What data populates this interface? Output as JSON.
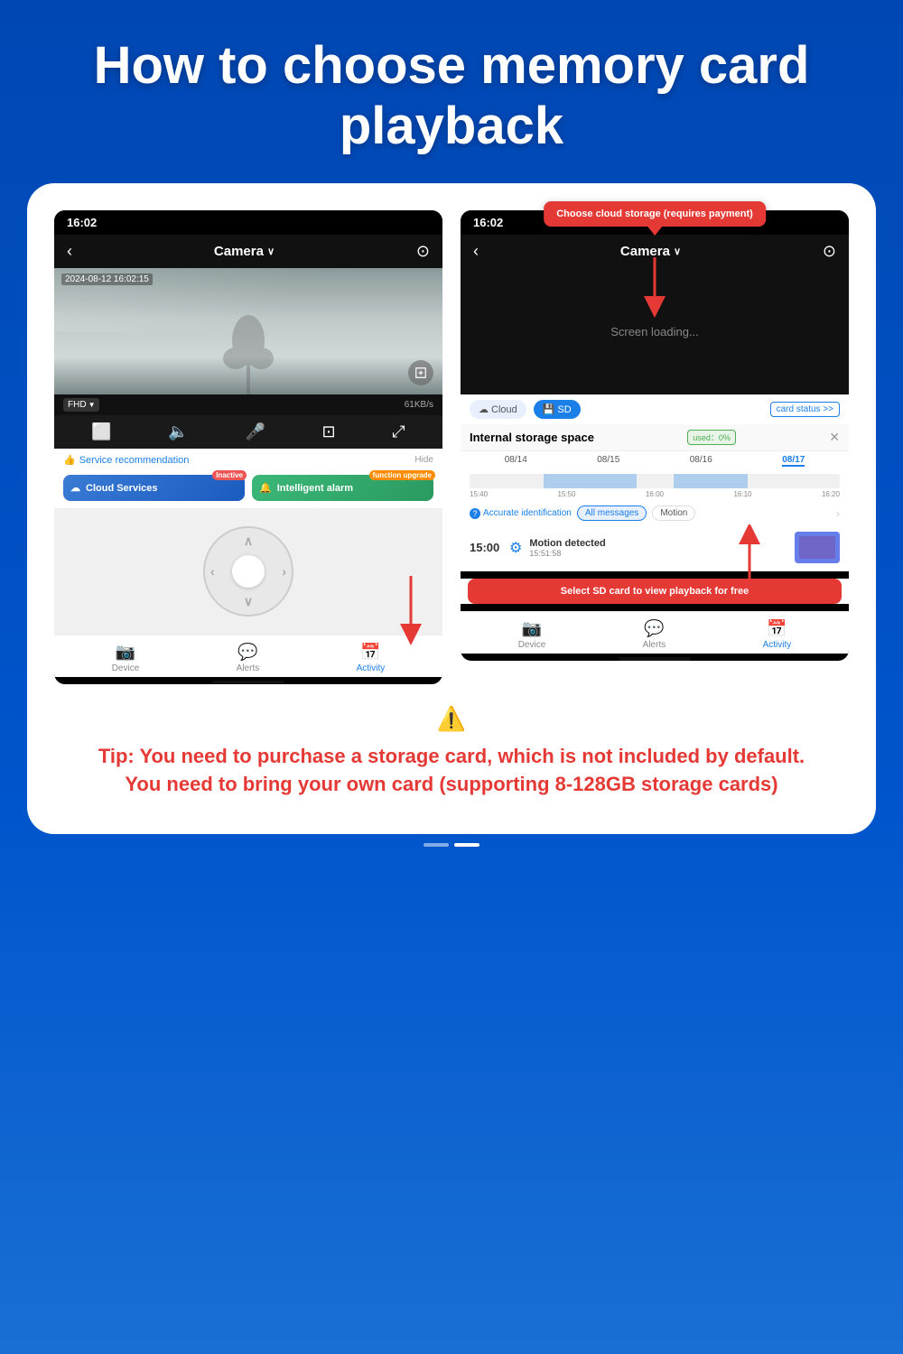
{
  "header": {
    "title": "How to choose memory card playback"
  },
  "left_phone": {
    "status_time": "16:02",
    "nav_title": "Camera",
    "camera_timestamp": "2024-08-12 16:02:15",
    "quality": "FHD",
    "speed": "61KB/s",
    "service_label": "Service recommendation",
    "hide_label": "Hide",
    "cloud_service": "Cloud Services",
    "cloud_badge": "Inactive",
    "alarm_service": "Intelligent alarm",
    "alarm_badge": "function upgrade",
    "bottom_nav": {
      "device": "Device",
      "alerts": "Alerts",
      "activity": "Activity"
    }
  },
  "right_phone": {
    "status_time": "16:02",
    "nav_title": "Camera",
    "screen_loading": "Screen loading...",
    "cloud_tab": "Cloud",
    "sd_tab": "SD",
    "card_status": "card status >>",
    "storage_title": "Internal storage space",
    "used_label": "used：0%",
    "dates": [
      "08/14",
      "08/15",
      "08/16",
      "08/17"
    ],
    "times": [
      "15:40",
      "15:50",
      "16:00",
      "16:10",
      "16:20"
    ],
    "filter_label": "Accurate identification",
    "filter_chips": [
      "All messages",
      "Motion"
    ],
    "event_time": "15:00",
    "event_title": "Motion detected",
    "event_sub": "15:51:58",
    "bottom_nav": {
      "device": "Device",
      "alerts": "Alerts",
      "activity": "Activity"
    }
  },
  "callouts": {
    "cloud_callout": "Choose cloud storage (requires payment)",
    "sd_callout": "Select SD card to view playback for free"
  },
  "tip": {
    "icon": "⚠️",
    "text": "Tip: You need to purchase a storage card, which is not included by default. You need to bring your own card (supporting 8-128GB storage cards)"
  },
  "page_indicator": {
    "dots": [
      false,
      true
    ]
  }
}
